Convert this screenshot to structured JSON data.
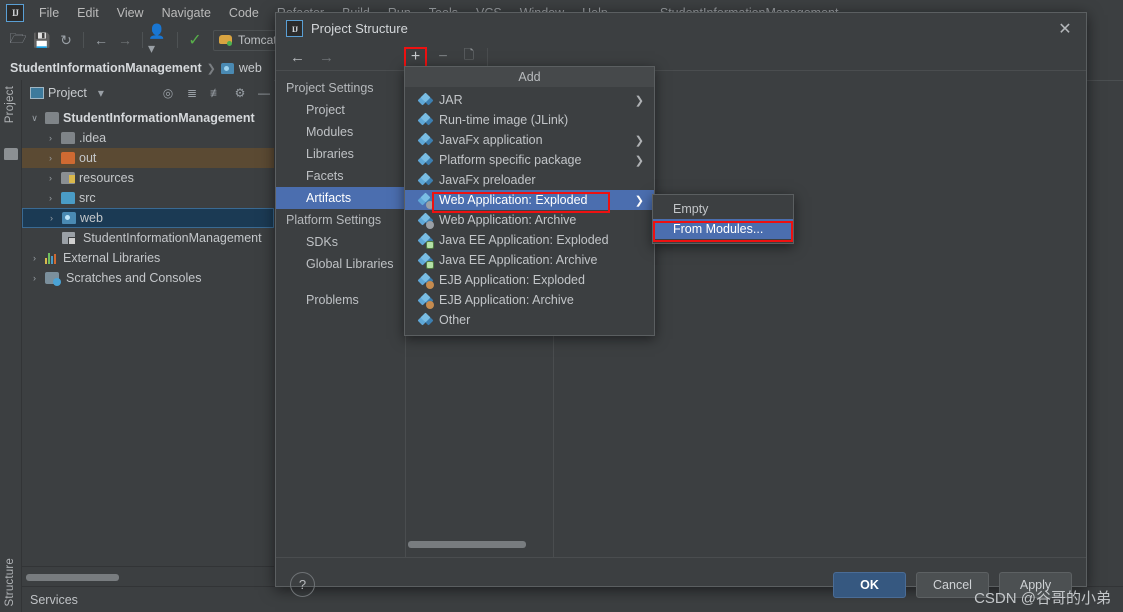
{
  "ide": {
    "logo_text": "IJ",
    "menus": [
      "File",
      "Edit",
      "View",
      "Navigate",
      "Code",
      "Refactor",
      "Build",
      "Run",
      "Tools",
      "VCS",
      "Window",
      "Help"
    ],
    "window_title": "StudentInformationManagement",
    "toolbar": {
      "open_icon": "folder-open-icon",
      "save_icon": "save-icon",
      "sync_icon": "sync-icon",
      "back_icon": "back-arrow-icon",
      "forward_icon": "forward-arrow-icon",
      "profile_icon": "user-icon",
      "hammer_icon": "build-icon",
      "run_config": "Tomcat"
    },
    "breadcrumb": [
      "StudentInformationManagement",
      "web"
    ],
    "left_strips": [
      "Project",
      "Structure"
    ],
    "status_bar": {
      "services_label": "Services"
    }
  },
  "project_panel": {
    "title": "Project",
    "header_icons": [
      "locate-icon",
      "expand-all-icon",
      "collapse-all-icon",
      "settings-gear-icon",
      "hide-icon"
    ],
    "tree": [
      {
        "label": "StudentInformationManagement",
        "arrow": "∨",
        "icon": "module-folder-icon",
        "indent": 0,
        "state": "root"
      },
      {
        "label": ".idea",
        "arrow": "›",
        "icon": "folder-icon",
        "indent": 1,
        "state": ""
      },
      {
        "label": "out",
        "arrow": "›",
        "icon": "output-folder-icon",
        "indent": 1,
        "state": "selected-inactive"
      },
      {
        "label": "resources",
        "arrow": "›",
        "icon": "resources-folder-icon",
        "indent": 1,
        "state": ""
      },
      {
        "label": "src",
        "arrow": "›",
        "icon": "source-folder-icon",
        "indent": 1,
        "state": ""
      },
      {
        "label": "web",
        "arrow": "›",
        "icon": "web-folder-icon",
        "indent": 1,
        "state": "selected"
      },
      {
        "label": "StudentInformationManagement",
        "arrow": "",
        "icon": "iml-module-icon",
        "indent": 2,
        "state": ""
      },
      {
        "label": "External Libraries",
        "arrow": "›",
        "icon": "libraries-icon",
        "indent": 0,
        "state": ""
      },
      {
        "label": "Scratches and Consoles",
        "arrow": "›",
        "icon": "scratches-icon",
        "indent": 0,
        "state": ""
      }
    ]
  },
  "dialog": {
    "title": "Project Structure",
    "logo_text": "IJ",
    "close_icon": "close-icon",
    "toolbar": {
      "back_icon": "back-arrow-icon",
      "forward_icon": "forward-arrow-icon",
      "add_icon": "plus-icon",
      "remove_icon": "minus-icon",
      "copy_icon": "copy-icon"
    },
    "nav": [
      {
        "label": "Project Settings",
        "type": "category"
      },
      {
        "label": "Project",
        "type": "item"
      },
      {
        "label": "Modules",
        "type": "item"
      },
      {
        "label": "Libraries",
        "type": "item"
      },
      {
        "label": "Facets",
        "type": "item"
      },
      {
        "label": "Artifacts",
        "type": "item",
        "active": true
      },
      {
        "label": "Platform Settings",
        "type": "category"
      },
      {
        "label": "SDKs",
        "type": "item"
      },
      {
        "label": "Global Libraries",
        "type": "item"
      },
      {
        "label": "Problems",
        "type": "item"
      }
    ],
    "footer": {
      "help_label": "?",
      "ok_label": "OK",
      "cancel_label": "Cancel",
      "apply_label": "Apply"
    }
  },
  "add_menu": {
    "title": "Add",
    "items": [
      {
        "label": "JAR",
        "icon": "artifact-jar-icon",
        "submenu": true
      },
      {
        "label": "Run-time image (JLink)",
        "icon": "artifact-jlink-icon",
        "submenu": false
      },
      {
        "label": "JavaFx application",
        "icon": "artifact-javafx-icon",
        "submenu": true
      },
      {
        "label": "Platform specific package",
        "icon": "artifact-platform-icon",
        "submenu": true
      },
      {
        "label": "JavaFx preloader",
        "icon": "artifact-preloader-icon",
        "submenu": false
      },
      {
        "label": "Web Application: Exploded",
        "icon": "artifact-web-exploded-icon",
        "submenu": true,
        "highlight": true,
        "annotated": true
      },
      {
        "label": "Web Application: Archive",
        "icon": "artifact-web-archive-icon",
        "submenu": false
      },
      {
        "label": "Java EE Application: Exploded",
        "icon": "artifact-javaee-exploded-icon",
        "submenu": false
      },
      {
        "label": "Java EE Application: Archive",
        "icon": "artifact-javaee-archive-icon",
        "submenu": false
      },
      {
        "label": "EJB Application: Exploded",
        "icon": "artifact-ejb-exploded-icon",
        "submenu": false
      },
      {
        "label": "EJB Application: Archive",
        "icon": "artifact-ejb-archive-icon",
        "submenu": false
      },
      {
        "label": "Other",
        "icon": "artifact-other-icon",
        "submenu": false
      }
    ]
  },
  "sub_menu": {
    "items": [
      {
        "label": "Empty",
        "highlight": false
      },
      {
        "label": "From Modules...",
        "highlight": true,
        "annotated": true
      }
    ]
  },
  "annotations": {
    "accent_color": "#ee1111",
    "highlight_color": "#4b6eaf",
    "primary_button_color": "#365880"
  },
  "watermark": {
    "text": "CSDN @谷哥的小弟"
  }
}
